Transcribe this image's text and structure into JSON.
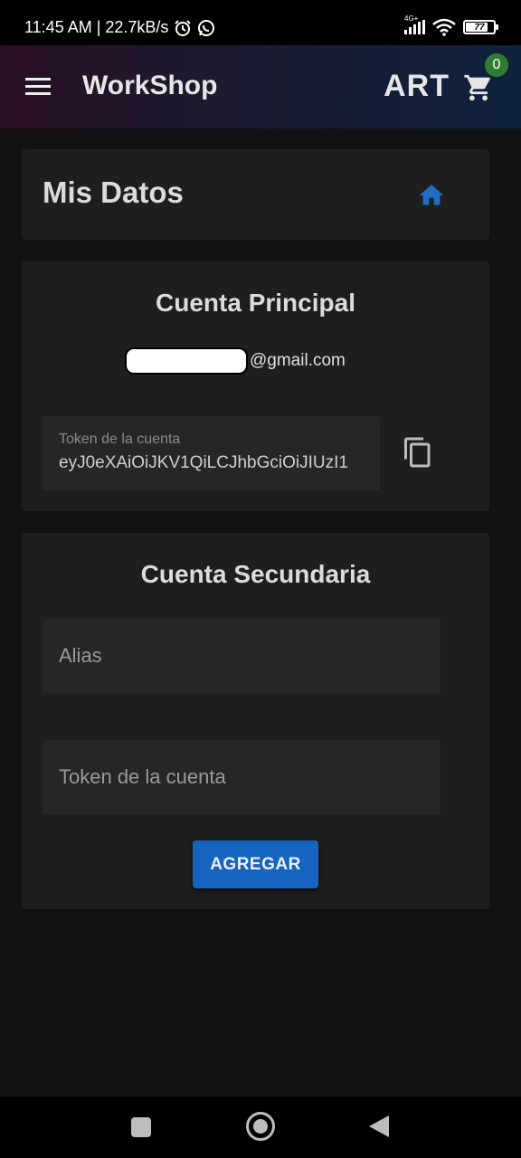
{
  "status_bar": {
    "time_speed": "11:45 AM | 22.7kB/s",
    "network_tag": "4G+",
    "battery": "77"
  },
  "app_bar": {
    "title": "WorkShop",
    "right_label": "ART",
    "cart_count": "0"
  },
  "header_card": {
    "title": "Mis Datos"
  },
  "principal": {
    "title": "Cuenta Principal",
    "email_suffix": "@gmail.com",
    "token_label": "Token de la cuenta",
    "token_value": "eyJ0eXAiOiJKV1QiLCJhbGciOiJIUzI1"
  },
  "secundaria": {
    "title": "Cuenta Secundaria",
    "alias_placeholder": "Alias",
    "token_placeholder": "Token de la cuenta",
    "add_button": "AGREGAR"
  },
  "colors": {
    "accent_blue": "#1565c0",
    "badge_green": "#2e7d32",
    "background": "#121212",
    "card": "#1e1e1e"
  },
  "icons": [
    "menu-icon",
    "cart-icon",
    "home-icon",
    "copy-icon",
    "alarm-icon",
    "whatsapp-icon",
    "wifi-icon",
    "signal-icon",
    "battery-icon"
  ]
}
